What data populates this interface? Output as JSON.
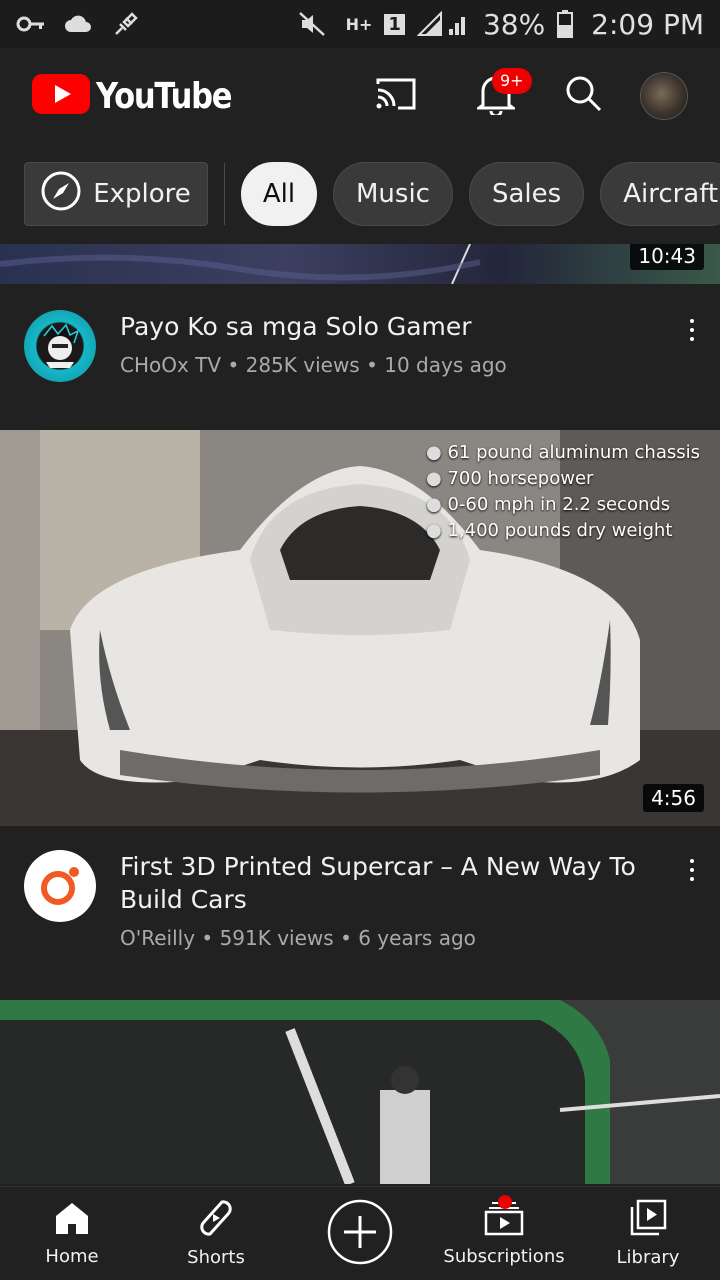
{
  "status_bar": {
    "network": "H+",
    "sim": "1",
    "battery": "38%",
    "time": "2:09 PM",
    "icons": [
      "key-icon",
      "cloud-icon",
      "satellite-icon",
      "mute-icon",
      "signal-icon",
      "battery-icon"
    ]
  },
  "header": {
    "app_name": "YouTube",
    "notification_badge": "9+",
    "brand_color": "#FF0000"
  },
  "chips": {
    "explore_label": "Explore",
    "items": [
      "All",
      "Music",
      "Sales",
      "Aircraft"
    ],
    "active": "All"
  },
  "feed": {
    "top_partial": {
      "duration": "10:43"
    },
    "video1": {
      "title": "Payo Ko sa mga Solo Gamer",
      "channel": "CHoOx TV",
      "views": "285K views",
      "age": "10 days ago"
    },
    "video2": {
      "duration": "4:56",
      "overlay": [
        "61 pound aluminum chassis",
        "700 horsepower",
        "0-60 mph in 2.2 seconds",
        "1,400 pounds dry weight"
      ],
      "title": "First 3D Printed Supercar – A New Way To Build Cars",
      "channel": "O'Reilly",
      "views": "591K views",
      "age": "6 years ago"
    }
  },
  "bottom_nav": {
    "home": "Home",
    "shorts": "Shorts",
    "subscriptions": "Subscriptions",
    "library": "Library"
  }
}
